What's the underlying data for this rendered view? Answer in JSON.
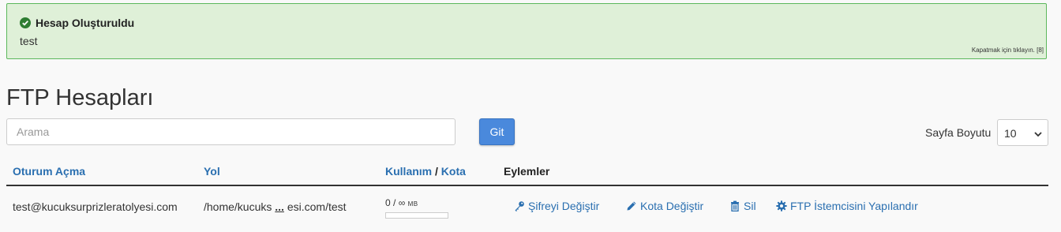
{
  "alert": {
    "title": "Hesap Oluşturuldu",
    "message": "test",
    "close_hint": "Kapatmak için tıklayın. [8]"
  },
  "page": {
    "title": "FTP Hesapları"
  },
  "search": {
    "placeholder": "Arama",
    "go_label": "Git"
  },
  "pagination": {
    "label": "Sayfa Boyutu",
    "selected": "10"
  },
  "table": {
    "headers": {
      "login": "Oturum Açma",
      "path": "Yol",
      "usage": "Kullanım",
      "separator": "/",
      "quota": "Kota",
      "actions": "Eylemler"
    },
    "rows": [
      {
        "login": "test@kucuksurprizleratolyesi.com",
        "path_start": "/home/kucuks",
        "path_ellipsis": "...",
        "path_end": "esi.com/test",
        "usage": "0",
        "usage_sep": "/",
        "quota": "∞",
        "unit": "MB",
        "usage_fraction": 0,
        "actions": {
          "change_password": "Şifreyi Değiştir",
          "change_quota": "Kota Değiştir",
          "delete": "Sil",
          "configure_client": "FTP İstemcisini Yapılandır"
        }
      }
    ]
  },
  "colors": {
    "alert_bg": "#dff0d8",
    "alert_border": "#5cb85c",
    "accent": "#4a89dc",
    "link": "#2a6fb0"
  }
}
